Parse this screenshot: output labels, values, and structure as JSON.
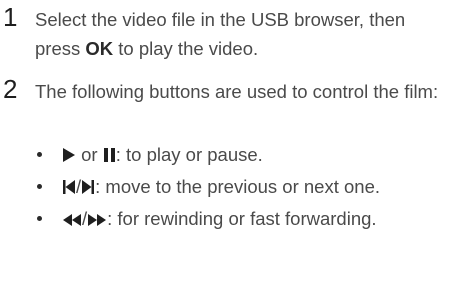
{
  "steps": [
    {
      "number": "1",
      "text_before": "Select the video file in the USB browser, then press ",
      "bold": "OK",
      "text_after": " to play the video."
    },
    {
      "number": "2",
      "text": "The following buttons are used to control the film:"
    }
  ],
  "controls": [
    {
      "icons": [
        "play-icon",
        "pause-icon"
      ],
      "separator": " or ",
      "text": ": to play or pause."
    },
    {
      "icons": [
        "previous-icon",
        "next-icon"
      ],
      "separator": "/",
      "text": ": move to the previous or next one."
    },
    {
      "icons": [
        "rewind-icon",
        "fast-forward-icon"
      ],
      "separator": "/",
      "text": ": for rewinding or fast forwarding."
    }
  ]
}
